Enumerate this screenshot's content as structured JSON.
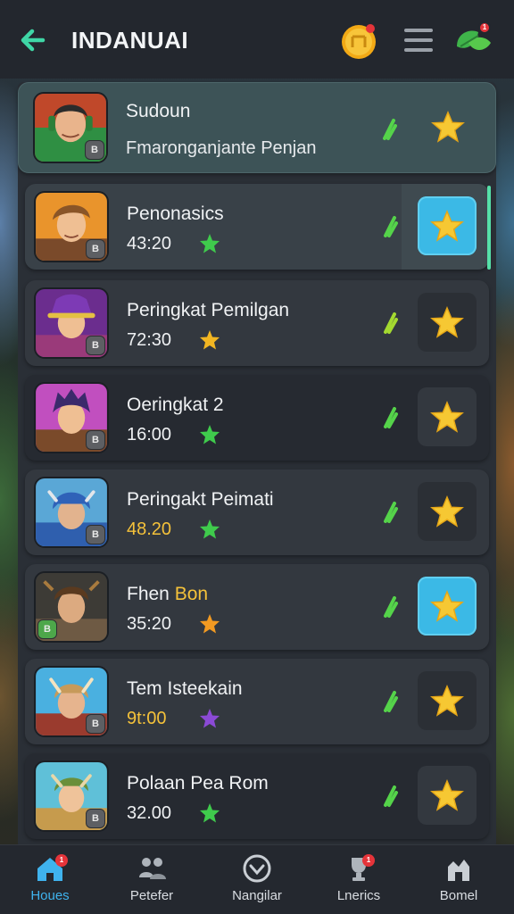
{
  "header": {
    "title": "INDANUAI",
    "back_icon": "arrow-left-icon",
    "coin_icon": "coin-icon",
    "menu_icon": "hamburger-menu-icon",
    "gift_icon": "leaf-gift-icon",
    "gift_badge": "1",
    "accent_color": "#3fd6a6"
  },
  "rows": [
    {
      "name": "Sudoun",
      "subtitle": "Fmaronganjante Penjan",
      "badge": "B",
      "favorited": false,
      "style": "featured"
    },
    {
      "name": "Penonasics",
      "time": "43:20",
      "star_color": "#3fcb4c",
      "badge": "B",
      "favorited": true,
      "selected": true
    },
    {
      "name": "Peringkat Pemilgan",
      "time": "72:30",
      "star_color": "#f2b622",
      "badge": "B",
      "favorited": false
    },
    {
      "name": "Oeringkat 2",
      "time": "16:00",
      "star_color": "#3fcb4c",
      "badge": "B",
      "favorited": false
    },
    {
      "name": "Peringakt Peimati",
      "time": "48.20",
      "time_gold": true,
      "star_color": "#3fcb4c",
      "badge": "B",
      "favorited": false
    },
    {
      "name_main": "Fhen ",
      "name_accent": "Bon",
      "time": "35:20",
      "star_color": "#f29a22",
      "badge": "B",
      "favorited": true
    },
    {
      "name": "Tem Isteekain",
      "time": "9t:00",
      "time_gold": true,
      "star_color": "#8b4ad6",
      "badge": "B",
      "favorited": false
    },
    {
      "name": "Polaan Pea Rom",
      "time": "32.00",
      "star_color": "#3fcb4c",
      "badge": "B",
      "favorited": false
    }
  ],
  "bottom_nav": [
    {
      "label": "Houes",
      "icon": "home-icon",
      "active": true,
      "badge": "1"
    },
    {
      "label": "Petefer",
      "icon": "people-icon",
      "active": false
    },
    {
      "label": "Nangilar",
      "icon": "compass-icon",
      "active": false
    },
    {
      "label": "Lnerics",
      "icon": "trophy-icon",
      "active": false,
      "badge": "1"
    },
    {
      "label": "Bomel",
      "icon": "castle-icon",
      "active": false
    }
  ]
}
